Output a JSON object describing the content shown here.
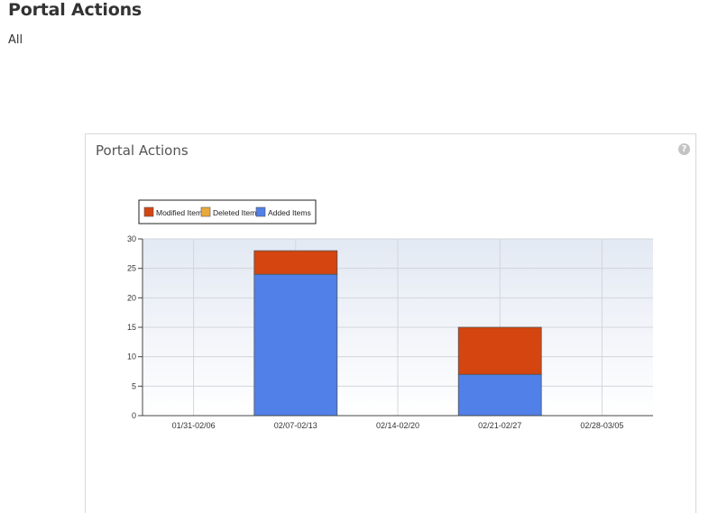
{
  "header": {
    "title": "Portal Actions",
    "filter": "All"
  },
  "panel": {
    "title": "Portal Actions",
    "help_icon": "question-circle-icon",
    "help_symbol": "?"
  },
  "colors": {
    "modified": "#d4450f",
    "deleted": "#eaa93c",
    "added": "#5080e8"
  },
  "chart_data": {
    "type": "bar",
    "stacked": true,
    "categories": [
      "01/31-02/06",
      "02/07-02/13",
      "02/14-02/20",
      "02/21-02/27",
      "02/28-03/05"
    ],
    "series": [
      {
        "name": "Added Items",
        "values": [
          0,
          24,
          0,
          7,
          0
        ]
      },
      {
        "name": "Deleted Items",
        "values": [
          0,
          0,
          0,
          0,
          0
        ]
      },
      {
        "name": "Modified Items",
        "values": [
          0,
          4,
          0,
          8,
          0
        ]
      }
    ],
    "legend_order": [
      "Modified Items",
      "Deleted Items",
      "Added Items"
    ],
    "yticks": [
      0,
      5,
      10,
      15,
      20,
      25,
      30
    ],
    "ylim": [
      0,
      30
    ],
    "grid": true,
    "legend_position": "top-left"
  }
}
